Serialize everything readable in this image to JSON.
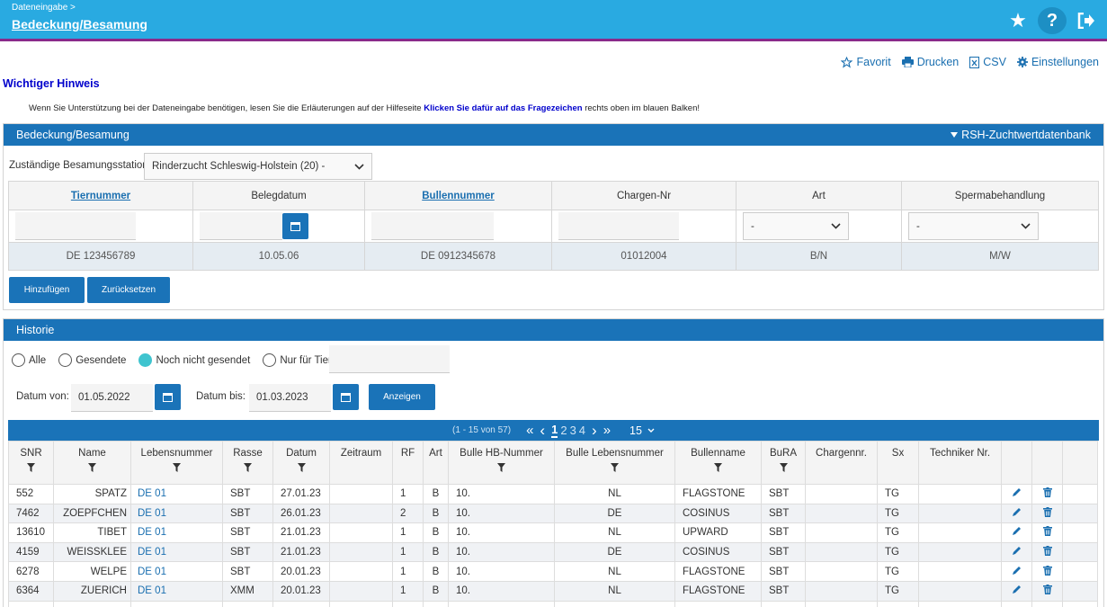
{
  "header": {
    "breadcrumb": "Dateneingabe >",
    "title": "Bedeckung/Besamung",
    "help_glyph": "?"
  },
  "toolbar": {
    "favorit": "Favorit",
    "drucken": "Drucken",
    "csv": "CSV",
    "einstellungen": "Einstellungen"
  },
  "hint": {
    "title": "Wichtiger Hinweis",
    "text_before": "Wenn Sie Unterstützung bei der Dateneingabe benötigen, lesen Sie die Erläuterungen auf der Hilfeseite ",
    "text_bold": "Klicken Sie dafür auf das Fragezeichen",
    "text_after": " rechts oben im blauen Balken!"
  },
  "entry": {
    "section_title": "Bedeckung/Besamung",
    "db_link": "RSH-Zuchtwertdatenbank",
    "station_label": "Zuständige Besamungsstation:",
    "station_value": "Rinderzucht Schleswig-Holstein (20) -",
    "columns": [
      "Tiernummer",
      "Belegdatum",
      "Bullennummer",
      "Chargen-Nr",
      "Art",
      "Spermabehandlung"
    ],
    "art_value": "-",
    "sperma_value": "-",
    "examples": [
      "DE 123456789",
      "10.05.06",
      "DE 0912345678",
      "01012004",
      "B/N",
      "M/W"
    ],
    "add_button": "Hinzufügen",
    "reset_button": "Zurücksetzen"
  },
  "history": {
    "section_title": "Historie",
    "filters": [
      "Alle",
      "Gesendete",
      "Noch nicht gesendet",
      "Nur für Tier:"
    ],
    "selected_filter": "Noch nicht gesendet",
    "tier_value": "",
    "date_from_label": "Datum von:",
    "date_from": "01.05.2022",
    "date_to_label": "Datum bis:",
    "date_to": "01.03.2023",
    "show_button": "Anzeigen",
    "pagination": {
      "range": "(1 - 15 von 57)",
      "first": "«",
      "prev": "‹",
      "next": "›",
      "last": "»",
      "pages": [
        "1",
        "2",
        "3",
        "4"
      ],
      "current": "1",
      "page_size": "15"
    },
    "columns": [
      "SNR",
      "Name",
      "Lebensnummer",
      "Rasse",
      "Datum",
      "Zeitraum",
      "RF",
      "Art",
      "Bulle HB-Nummer",
      "Bulle Lebensnummer",
      "Bullenname",
      "BuRA",
      "Chargennr.",
      "Sx",
      "Techniker Nr."
    ],
    "rows": [
      {
        "snr": "552",
        "name": "SPATZ",
        "leben": "DE 01",
        "rasse": "SBT",
        "datum": "27.01.23",
        "zeitraum": "",
        "rf": "1",
        "art": "B",
        "hb": "10.",
        "bleben": "NL",
        "bname": "FLAGSTONE",
        "bura": "SBT",
        "charge": "",
        "sx": "TG",
        "tech": ""
      },
      {
        "snr": "7462",
        "name": "ZOEPFCHEN",
        "leben": "DE 01",
        "rasse": "SBT",
        "datum": "26.01.23",
        "zeitraum": "",
        "rf": "2",
        "art": "B",
        "hb": "10.",
        "bleben": "DE",
        "bname": "COSINUS",
        "bura": "SBT",
        "charge": "",
        "sx": "TG",
        "tech": ""
      },
      {
        "snr": "13610",
        "name": "TIBET",
        "leben": "DE 01",
        "rasse": "SBT",
        "datum": "21.01.23",
        "zeitraum": "",
        "rf": "1",
        "art": "B",
        "hb": "10.",
        "bleben": "NL",
        "bname": "UPWARD",
        "bura": "SBT",
        "charge": "",
        "sx": "TG",
        "tech": ""
      },
      {
        "snr": "4159",
        "name": "WEISSKLEE",
        "leben": "DE 01",
        "rasse": "SBT",
        "datum": "21.01.23",
        "zeitraum": "",
        "rf": "1",
        "art": "B",
        "hb": "10.",
        "bleben": "DE",
        "bname": "COSINUS",
        "bura": "SBT",
        "charge": "",
        "sx": "TG",
        "tech": ""
      },
      {
        "snr": "6278",
        "name": "WELPE",
        "leben": "DE 01",
        "rasse": "SBT",
        "datum": "20.01.23",
        "zeitraum": "",
        "rf": "1",
        "art": "B",
        "hb": "10.",
        "bleben": "NL",
        "bname": "FLAGSTONE",
        "bura": "SBT",
        "charge": "",
        "sx": "TG",
        "tech": ""
      },
      {
        "snr": "6364",
        "name": "ZUERICH",
        "leben": "DE 01",
        "rasse": "XMM",
        "datum": "20.01.23",
        "zeitraum": "",
        "rf": "1",
        "art": "B",
        "hb": "10.",
        "bleben": "NL",
        "bname": "FLAGSTONE",
        "bura": "SBT",
        "charge": "",
        "sx": "TG",
        "tech": ""
      },
      {
        "snr": "",
        "name": "",
        "leben": "",
        "rasse": "",
        "datum": "",
        "zeitraum": "",
        "rf": "",
        "art": "",
        "hb": "",
        "bleben": "",
        "bname": "",
        "bura": "",
        "charge": "",
        "sx": "",
        "tech": ""
      }
    ]
  },
  "colors": {
    "topbar": "#29aae1",
    "section_header": "#1a73b8",
    "accent_line": "#8a2a8a",
    "radio_selected": "#3fc4cf"
  },
  "icons": [
    "star-icon",
    "help-icon",
    "logout-icon",
    "print-icon",
    "csv-icon",
    "gear-icon",
    "calendar-icon",
    "chevron-down-icon",
    "filter-icon",
    "edit-icon",
    "trash-icon"
  ]
}
